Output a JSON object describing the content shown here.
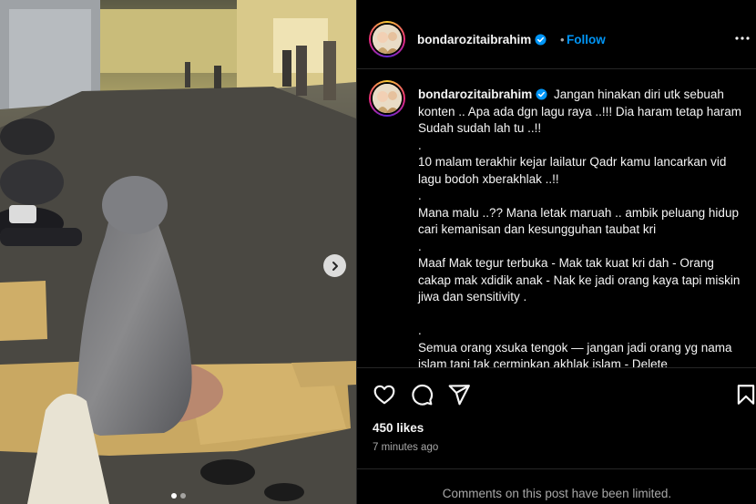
{
  "post": {
    "username": "bondarozitaibrahim",
    "follow_separator": "•",
    "follow_label": "Follow",
    "more_icon": "more-horizontal-icon",
    "verified_icon": "verified-badge-icon"
  },
  "caption": {
    "username": "bondarozitaibrahim",
    "lines": [
      "Jangan hinakan diri utk sebuah konten .. Apa ada dgn lagu raya ..!!! Dia haram tetap haram Sudah sudah lah tu ..!!",
      ".",
      "10 malam terakhir kejar lailatur Qadr kamu lancarkan vid lagu bodoh xberakhlak ..!!",
      ".",
      "Mana malu ..?? Mana letak maruah .. ambik peluang hidup cari kemanisan dan kesungguhan taubat kri",
      ".",
      "Maaf Mak tegur terbuka - Mak tak kuat kri dah - Orang cakap mak xdidik anak - Nak ke jadi orang kaya tapi miskin jiwa dan sensitivity .",
      "",
      ".",
      "Semua orang xsuka tengok — jangan jadi orang yg nama islam tapi tak cerminkan akhlak islam - Delete"
    ]
  },
  "actions": {
    "like_icon": "heart-icon",
    "comment_icon": "comment-icon",
    "share_icon": "send-icon",
    "save_icon": "bookmark-icon"
  },
  "likes": "450 likes",
  "timestamp": "7 minutes ago",
  "comments_notice": "Comments on this post have been limited.",
  "carousel": {
    "next_icon": "chevron-right-icon",
    "slides": 2,
    "active_slide": 1
  },
  "colors": {
    "background": "#000000",
    "link": "#0095f6",
    "secondary_text": "#a8a8a8",
    "divider": "#262626"
  }
}
